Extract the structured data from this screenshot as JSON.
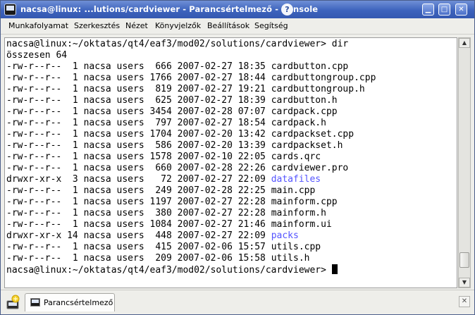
{
  "window": {
    "title": "nacsa@linux: ...lutions/cardviewer - Parancsértelmező - Konsole",
    "help_glyph": "?",
    "minimize_glyph": "▁",
    "maximize_glyph": "□",
    "close_glyph": "✕"
  },
  "menubar": {
    "items": [
      "Munkafolyamat",
      "Szerkesztés",
      "Nézet",
      "Könyvjelzők",
      "Beállítások",
      "Segítség"
    ]
  },
  "terminal": {
    "lines": [
      {
        "text": "nacsa@linux:~/oktatas/qt4/eaf3/mod02/solutions/cardviewer> dir"
      },
      {
        "text": "összesen 64"
      },
      {
        "text": "-rw-r--r--  1 nacsa users  666 2007-02-27 18:35 ",
        "name": "cardbutton.cpp"
      },
      {
        "text": "-rw-r--r--  1 nacsa users 1766 2007-02-27 18:44 ",
        "name": "cardbuttongroup.cpp"
      },
      {
        "text": "-rw-r--r--  1 nacsa users  819 2007-02-27 19:21 ",
        "name": "cardbuttongroup.h"
      },
      {
        "text": "-rw-r--r--  1 nacsa users  625 2007-02-27 18:39 ",
        "name": "cardbutton.h"
      },
      {
        "text": "-rw-r--r--  1 nacsa users 3454 2007-02-28 07:07 ",
        "name": "cardpack.cpp"
      },
      {
        "text": "-rw-r--r--  1 nacsa users  797 2007-02-27 18:54 ",
        "name": "cardpack.h"
      },
      {
        "text": "-rw-r--r--  1 nacsa users 1704 2007-02-20 13:42 ",
        "name": "cardpackset.cpp"
      },
      {
        "text": "-rw-r--r--  1 nacsa users  586 2007-02-20 13:39 ",
        "name": "cardpackset.h"
      },
      {
        "text": "-rw-r--r--  1 nacsa users 1578 2007-02-10 22:05 ",
        "name": "cards.qrc"
      },
      {
        "text": "-rw-r--r--  1 nacsa users  660 2007-02-28 22:26 ",
        "name": "cardviewer.pro"
      },
      {
        "text": "drwxr-xr-x  3 nacsa users   72 2007-02-27 22:09 ",
        "name": "datafiles",
        "dir": true
      },
      {
        "text": "-rw-r--r--  1 nacsa users  249 2007-02-28 22:25 ",
        "name": "main.cpp"
      },
      {
        "text": "-rw-r--r--  1 nacsa users 1197 2007-02-27 22:28 ",
        "name": "mainform.cpp"
      },
      {
        "text": "-rw-r--r--  1 nacsa users  380 2007-02-27 22:28 ",
        "name": "mainform.h"
      },
      {
        "text": "-rw-r--r--  1 nacsa users 1084 2007-02-27 21:46 ",
        "name": "mainform.ui"
      },
      {
        "text": "drwxr-xr-x 14 nacsa users  448 2007-02-27 22:09 ",
        "name": "packs",
        "dir": true
      },
      {
        "text": "-rw-r--r--  1 nacsa users  415 2007-02-06 15:57 ",
        "name": "utils.cpp"
      },
      {
        "text": "-rw-r--r--  1 nacsa users  209 2007-02-06 15:58 ",
        "name": "utils.h"
      },
      {
        "text": "nacsa@linux:~/oktatas/qt4/eaf3/mod02/solutions/cardviewer> ",
        "prompt": true
      }
    ],
    "colors": {
      "foreground": "#000000",
      "directory": "#5454ff",
      "background": "#ffffff"
    }
  },
  "tabbar": {
    "tab_label": "Parancsértelmező",
    "new_session_icon": "new-session-icon",
    "close_glyph": "✕"
  }
}
